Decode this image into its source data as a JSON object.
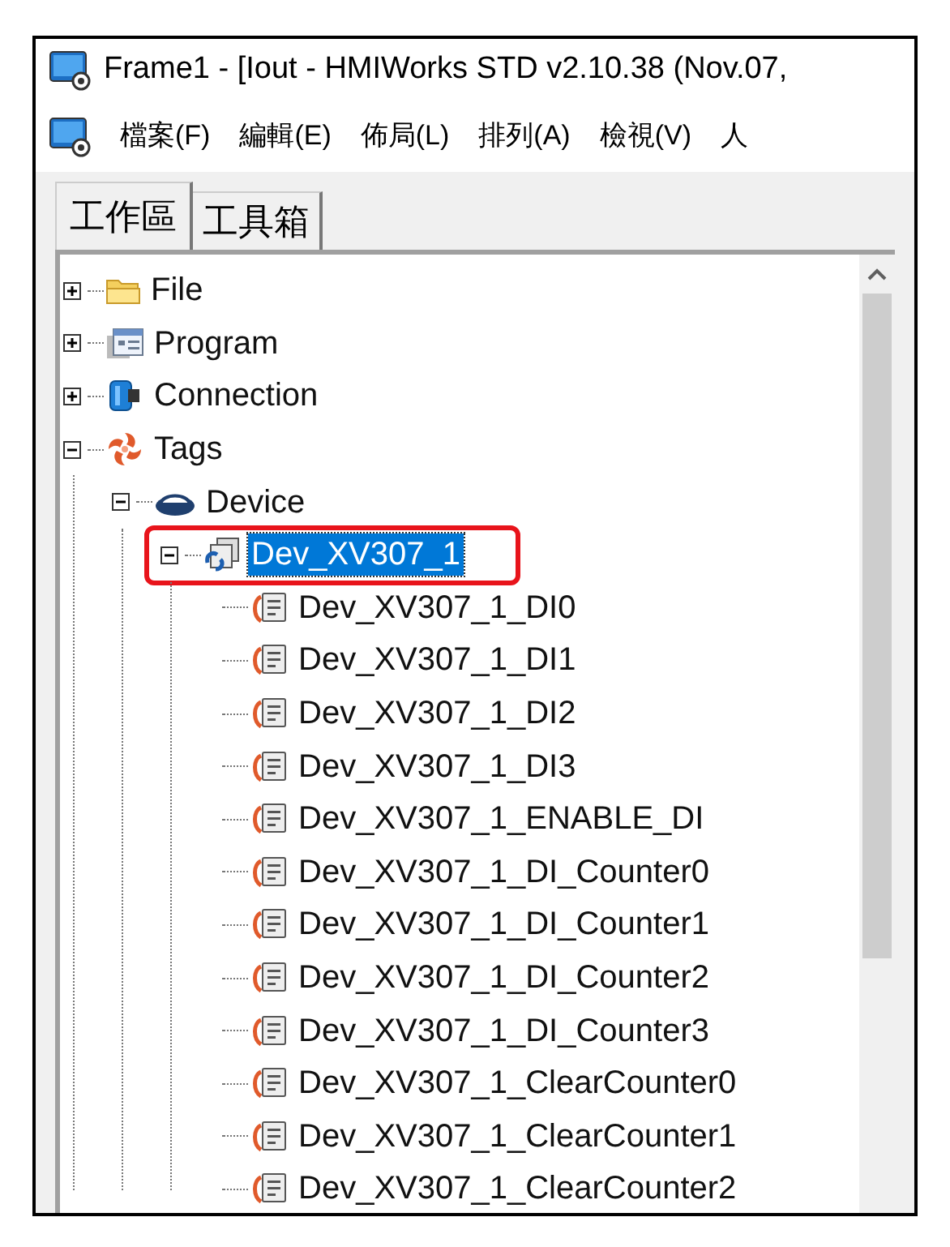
{
  "window": {
    "title": "Frame1 - [Iout - HMIWorks STD v2.10.38 (Nov.07,"
  },
  "menu": [
    "檔案(F)",
    "編輯(E)",
    "佈局(L)",
    "排列(A)",
    "檢視(V)",
    "人"
  ],
  "tabs": [
    {
      "label": "工作區",
      "selected": true
    },
    {
      "label": "工具箱",
      "selected": false
    }
  ],
  "tree": [
    {
      "label": "File",
      "kind": "folder",
      "expanded": false,
      "selected": false
    },
    {
      "label": "Program",
      "kind": "program",
      "expanded": false,
      "selected": false
    },
    {
      "label": "Connection",
      "kind": "connection",
      "expanded": false,
      "selected": false
    },
    {
      "label": "Tags",
      "kind": "tags",
      "expanded": true,
      "selected": false,
      "children": [
        {
          "label": "Device",
          "kind": "device",
          "expanded": true,
          "selected": false,
          "children": [
            {
              "label": "Dev_XV307_1",
              "kind": "module",
              "expanded": true,
              "selected": true,
              "highlighted": true,
              "children": [
                {
                  "label": "Dev_XV307_1_DI0",
                  "kind": "tag",
                  "selected": false
                },
                {
                  "label": "Dev_XV307_1_DI1",
                  "kind": "tag",
                  "selected": false
                },
                {
                  "label": "Dev_XV307_1_DI2",
                  "kind": "tag",
                  "selected": false
                },
                {
                  "label": "Dev_XV307_1_DI3",
                  "kind": "tag",
                  "selected": false
                },
                {
                  "label": "Dev_XV307_1_ENABLE_DI",
                  "kind": "tag",
                  "selected": false
                },
                {
                  "label": "Dev_XV307_1_DI_Counter0",
                  "kind": "tag",
                  "selected": false
                },
                {
                  "label": "Dev_XV307_1_DI_Counter1",
                  "kind": "tag",
                  "selected": false
                },
                {
                  "label": "Dev_XV307_1_DI_Counter2",
                  "kind": "tag",
                  "selected": false
                },
                {
                  "label": "Dev_XV307_1_DI_Counter3",
                  "kind": "tag",
                  "selected": false
                },
                {
                  "label": "Dev_XV307_1_ClearCounter0",
                  "kind": "tag",
                  "selected": false
                },
                {
                  "label": "Dev_XV307_1_ClearCounter1",
                  "kind": "tag",
                  "selected": false
                },
                {
                  "label": "Dev_XV307_1_ClearCounter2",
                  "kind": "tag",
                  "selected": false
                }
              ]
            }
          ]
        }
      ]
    }
  ]
}
